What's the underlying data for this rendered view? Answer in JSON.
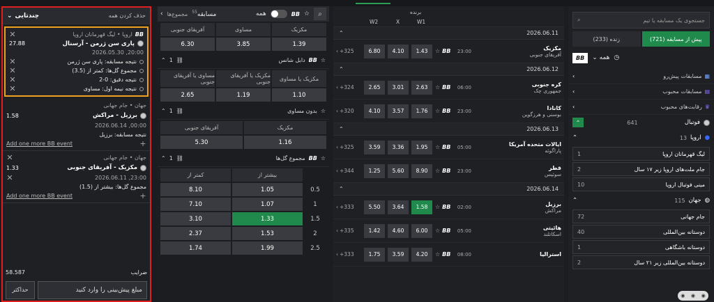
{
  "slip": {
    "header_label": "چندتایی",
    "clear_all": "حذف کردن همه",
    "cards": [
      {
        "league": "اروپا • لیگ قهرمانان اروپا",
        "match": "پاری سن ژرمن - آرسنال",
        "odds": "27.88",
        "datetime": "2026.05.30 ,20:00",
        "selections": [
          "نتیجه مسابقه: پاری سن ژرمن",
          "مجموع گل‌ها: کمتر از (3.5)",
          "نتیجه دقیق: 0-2",
          "نتیجه نیمه اول: مساوی"
        ]
      },
      {
        "league": "جهان • جام جهانی",
        "match": "برزیل - مراکش",
        "odds": "1.58",
        "datetime": "2026.06.14 ,00:00",
        "selections": [
          "نتیجه مسابقه: برزیل"
        ],
        "add": "Add one more BB event"
      },
      {
        "league": "جهان • جام جهانی",
        "match": "مکزیک - آفریقای جنوبی",
        "odds": "1.33",
        "datetime": "2026.06.11 ,23:00",
        "selections": [
          "مجموع گل‌ها: بیشتر از (1.5)"
        ],
        "add": "Add one more BB event"
      }
    ],
    "total_label": "ضرایب",
    "total_value": "58.587",
    "max_button": "حداکثر",
    "amount_placeholder": "مبلغ پیش‌بینی را وارد کنید"
  },
  "market": {
    "all_label": "همه",
    "tab_match": "مسابقه",
    "tab_match_count": "55",
    "tab_total": "مجموع‌ها",
    "result_headers": [
      "مکزیک",
      "مساوی",
      "آفریقای جنوبی"
    ],
    "result_values": [
      "1.39",
      "3.85",
      "6.30"
    ],
    "double_chance_title": "دابل شانس",
    "double_chance_count": "1",
    "dc_headers": [
      "مکزیک یا مساوی",
      "مکزیک یا آفریقای جنوبی",
      "مساوی یا آفریقای جنوبی"
    ],
    "dc_values": [
      "1.10",
      "1.19",
      "2.65"
    ],
    "no_draw_title": "بدون مساوی",
    "no_draw_count": "1",
    "nd_headers": [
      "مکزیک",
      "آفریقای جنوبی"
    ],
    "nd_values": [
      "1.16",
      "5.30"
    ],
    "totals_title": "مجموع گل‌ها",
    "totals_count": "1",
    "totals_headers": [
      "بیشتر از",
      "کمتر از"
    ],
    "totals_rows": [
      {
        "line": "0.5",
        "over": "1.05",
        "under": "8.10"
      },
      {
        "line": "1",
        "over": "1.07",
        "under": "7.10"
      },
      {
        "line": "1.5",
        "over": "1.33",
        "under": "3.10"
      },
      {
        "line": "2",
        "over": "1.53",
        "under": "2.37"
      },
      {
        "line": "2.5",
        "over": "1.99",
        "under": "1.74"
      }
    ]
  },
  "list": {
    "col_w2": "W2",
    "col_x": "X",
    "col_w1": "W1",
    "col_winner": "برنده",
    "days": [
      {
        "date": "2026.06.11",
        "matches": [
          {
            "t1": "مکزیک",
            "t2": "آفریقای جنوبی",
            "time": "23:00",
            "w1": "1.43",
            "x": "4.10",
            "w2": "6.80",
            "more": "+325"
          }
        ]
      },
      {
        "date": "2026.06.12",
        "matches": [
          {
            "t1": "کره جنوبی",
            "t2": "جمهوری چک",
            "time": "06:00",
            "w1": "2.63",
            "x": "3.01",
            "w2": "2.65",
            "more": "+324"
          },
          {
            "t1": "کانادا",
            "t2": "بوسنی و هرزگوین",
            "time": "23:00",
            "w1": "1.76",
            "x": "3.57",
            "w2": "4.10",
            "more": "+320"
          }
        ]
      },
      {
        "date": "2026.06.13",
        "matches": [
          {
            "t1": "ایالات متحده آمریکا",
            "t2": "پاراگوئه",
            "time": "05:00",
            "w1": "1.95",
            "x": "3.36",
            "w2": "3.59",
            "more": "+325"
          },
          {
            "t1": "قطر",
            "t2": "سوئیس",
            "time": "23:00",
            "w1": "8.90",
            "x": "5.60",
            "w2": "1.25",
            "more": "+344"
          }
        ]
      },
      {
        "date": "2026.06.14",
        "matches": [
          {
            "t1": "برزیل",
            "t2": "مراکش",
            "time": "02:00",
            "w1": "1.58",
            "x": "3.64",
            "w2": "5.50",
            "more": "+333"
          },
          {
            "t1": "هائیتی",
            "t2": "اسکاتلند",
            "time": "05:00",
            "w1": "6.00",
            "x": "4.60",
            "w2": "1.42",
            "more": "+335"
          },
          {
            "t1": "استرالیا",
            "t2": "",
            "time": "08:00",
            "w1": "4.20",
            "x": "3.59",
            "w2": "1.75",
            "more": "+333"
          }
        ]
      }
    ]
  },
  "side": {
    "search_placeholder": "جستجوی یک مسابقه یا تیم",
    "tab_prematch": "پیش از مسابقه (721)",
    "tab_live": "زنده (233)",
    "filter_all": "همه",
    "bb": "BB",
    "items": [
      "مسابقات پیش‌رو",
      "مسابقات محبوب",
      "رقابت‌های محبوب"
    ],
    "football": "فوتبال",
    "football_count": "641",
    "europe": "اروپا",
    "europe_count": "13",
    "europe_leagues": [
      {
        "name": "لیگ قهرمانان اروپا",
        "count": "1"
      },
      {
        "name": "جام ملت‌های اروپا زیر ۱۷ سال",
        "count": "2"
      },
      {
        "name": "مینی فوتبال اروپا",
        "count": "10"
      }
    ],
    "world": "جهان",
    "world_count": "115",
    "world_leagues": [
      {
        "name": "جام جهانی",
        "count": "72"
      },
      {
        "name": "دوستانه بین‌المللی",
        "count": "40"
      },
      {
        "name": "دوستانه باشگاهی",
        "count": "1"
      },
      {
        "name": "دوستانه بین‌المللی زیر ۲۱ سال",
        "count": "2"
      }
    ]
  },
  "colors": {
    "accent": "#1f8a4c",
    "highlight_red": "#e02020",
    "highlight_orange": "#f0a020"
  }
}
